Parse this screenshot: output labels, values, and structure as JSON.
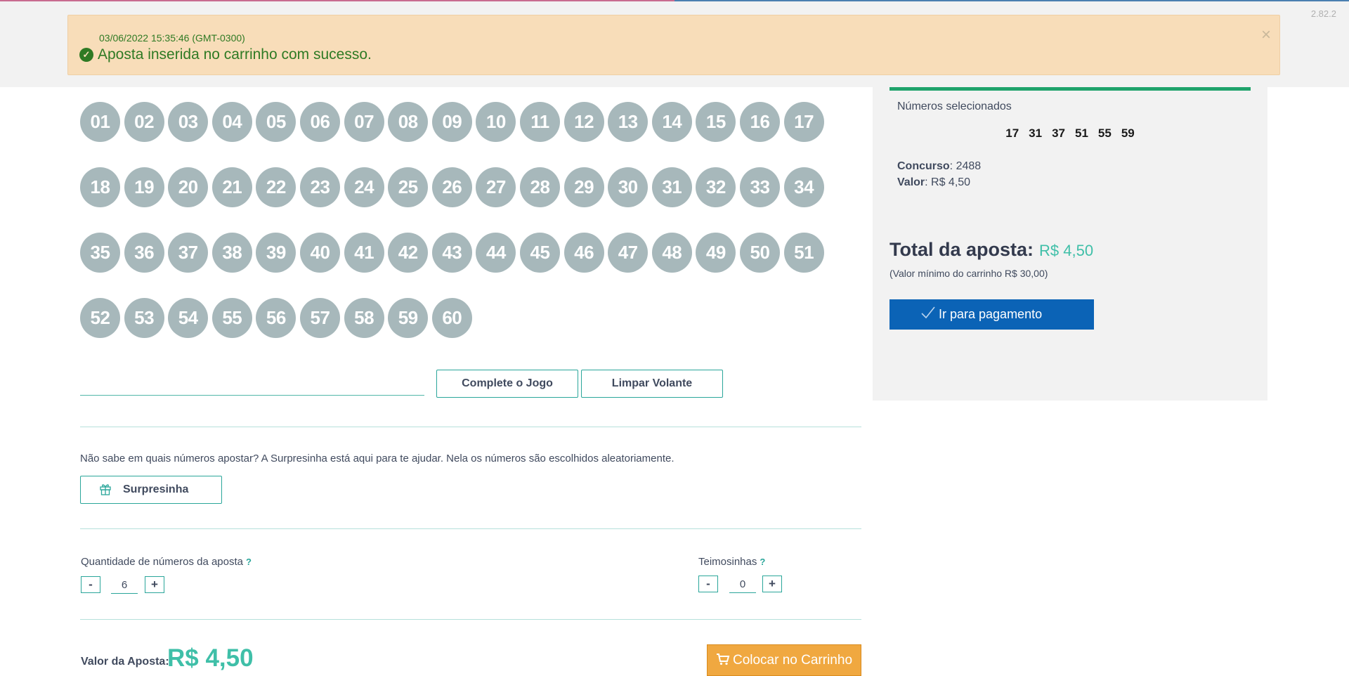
{
  "version": "2.82.2",
  "alert": {
    "timestamp": "03/06/2022 15:35:46 (GMT-0300)",
    "message": "Aposta inserida no carrinho com sucesso.",
    "close": "×"
  },
  "numbers": [
    "01",
    "02",
    "03",
    "04",
    "05",
    "06",
    "07",
    "08",
    "09",
    "10",
    "11",
    "12",
    "13",
    "14",
    "15",
    "16",
    "17",
    "18",
    "19",
    "20",
    "21",
    "22",
    "23",
    "24",
    "25",
    "26",
    "27",
    "28",
    "29",
    "30",
    "31",
    "32",
    "33",
    "34",
    "35",
    "36",
    "37",
    "38",
    "39",
    "40",
    "41",
    "42",
    "43",
    "44",
    "45",
    "46",
    "47",
    "48",
    "49",
    "50",
    "51",
    "52",
    "53",
    "54",
    "55",
    "56",
    "57",
    "58",
    "59",
    "60"
  ],
  "actions": {
    "input_value": "",
    "complete": "Complete o Jogo",
    "clear": "Limpar Volante"
  },
  "surpresinha": {
    "help": "Não sabe em quais números apostar? A Surpresinha está aqui para te ajudar. Nela os números são escolhidos aleatoriamente.",
    "button": "Surpresinha",
    "icon": "gift-icon"
  },
  "quantity": {
    "label": "Quantidade de números da aposta",
    "help_icon": "?",
    "minus": "-",
    "plus": "+",
    "value": "6"
  },
  "teimosinhas": {
    "label": "Teimosinhas",
    "help_icon": "?",
    "minus": "-",
    "plus": "+",
    "value": "0"
  },
  "bet": {
    "label": "Valor da Aposta:",
    "amount": "R$ 4,50",
    "cart_button": "Colocar no Carrinho",
    "cart_icon": "cart-icon"
  },
  "sidebar": {
    "selected_label": "Números selecionados",
    "selected": [
      "17",
      "31",
      "37",
      "51",
      "55",
      "59"
    ],
    "concurso_label": "Concurso",
    "concurso": ": 2488",
    "valor_label": "Valor",
    "valor": ": R$ 4,50",
    "total_label": "Total da aposta:",
    "total_amount": "R$ 4,50",
    "min_note": "(Valor mínimo do carrinho R$ 30,00)",
    "pay_button": "Ir para pagamento"
  },
  "colors": {
    "ball": "#a7b8bb",
    "accent": "#3fbfa8",
    "pay": "#0b63b6",
    "cart": "#f0a840",
    "alert_bg": "#f8ddb9",
    "alert_text": "#2f7a24"
  }
}
